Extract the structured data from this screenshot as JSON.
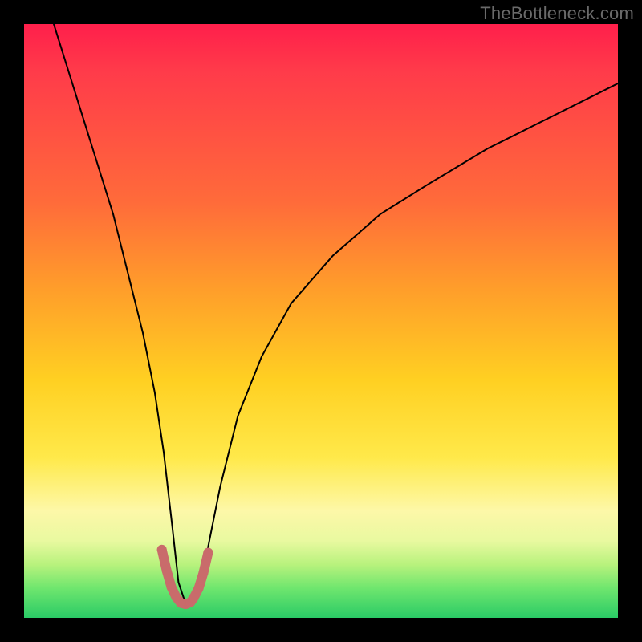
{
  "watermark": "TheBottleneck.com",
  "chart_data": {
    "type": "line",
    "title": "",
    "xlabel": "",
    "ylabel": "",
    "xlim": [
      0,
      100
    ],
    "ylim": [
      0,
      100
    ],
    "grid": false,
    "curve": {
      "x": [
        5,
        10,
        15,
        18,
        20,
        22,
        23.5,
        25,
        26,
        27,
        28,
        29,
        30,
        31,
        33,
        36,
        40,
        45,
        52,
        60,
        68,
        78,
        88,
        100
      ],
      "y": [
        100,
        84,
        68,
        56,
        48,
        38,
        28,
        15,
        6,
        3,
        2.5,
        3,
        6,
        12,
        22,
        34,
        44,
        53,
        61,
        68,
        73,
        79,
        84,
        90
      ]
    },
    "trough_marker": {
      "x": [
        23.2,
        24.0,
        24.8,
        25.6,
        26.4,
        27.2,
        28.0,
        28.6,
        29.4,
        30.2,
        31.0
      ],
      "y": [
        11.5,
        8.0,
        5.2,
        3.5,
        2.5,
        2.3,
        2.6,
        3.4,
        5.0,
        7.6,
        11.0
      ],
      "color": "#c96b6b",
      "width": 12
    },
    "gradient_stops": [
      {
        "pos": 0,
        "color": "#ff1f4b"
      },
      {
        "pos": 30,
        "color": "#ff6b3a"
      },
      {
        "pos": 60,
        "color": "#ffd022"
      },
      {
        "pos": 82,
        "color": "#fdf8a8"
      },
      {
        "pos": 100,
        "color": "#2acb66"
      }
    ]
  }
}
